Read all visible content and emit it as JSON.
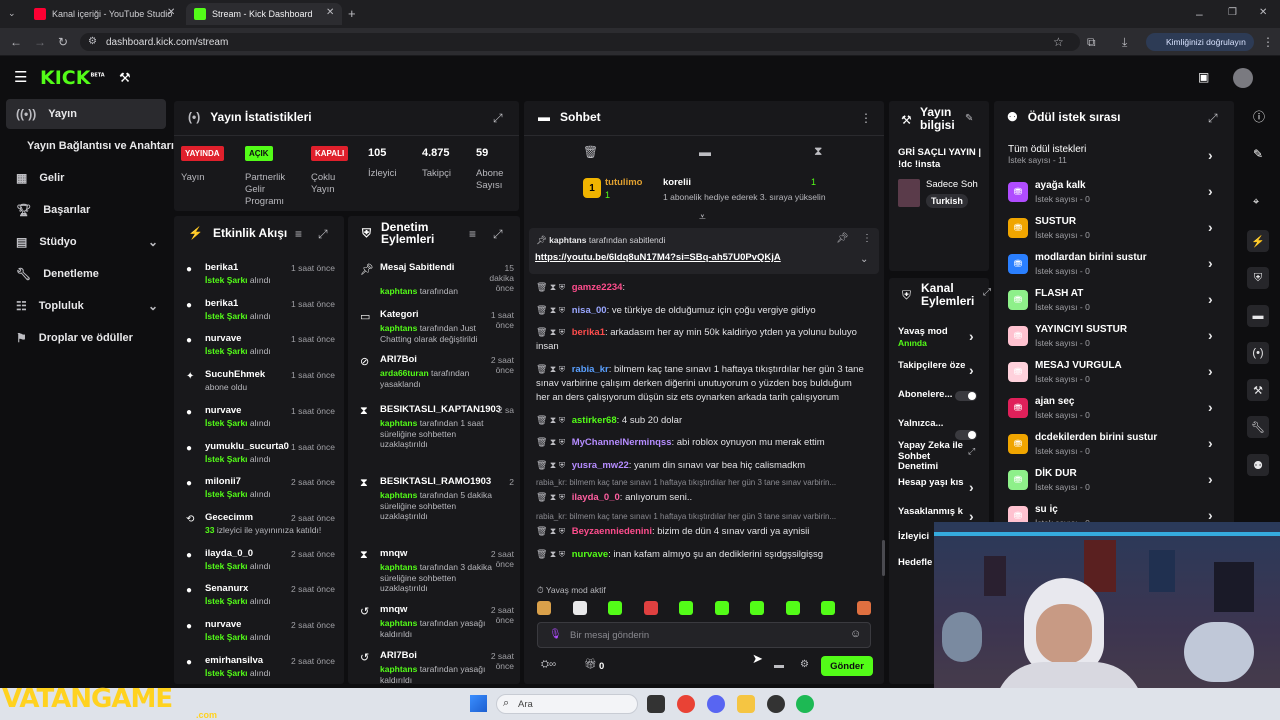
{
  "browser": {
    "tabs": [
      "Kanal içeriği - YouTube Studio",
      "Stream - Kick Dashboard"
    ],
    "url": "dashboard.kick.com/stream",
    "profile_pill": "Kimliğinizi doğrulayın"
  },
  "header": {
    "logo": "KICK",
    "beta": "BETA"
  },
  "sidebar": {
    "items": [
      {
        "label": "Yayın",
        "icon": "broadcast-icon"
      },
      {
        "label": "Yayın Bağlantısı ve Anahtarı",
        "icon": ""
      },
      {
        "label": "Gelir",
        "icon": "revenue-icon"
      },
      {
        "label": "Başarılar",
        "icon": "trophy-icon"
      },
      {
        "label": "Stüdyo",
        "icon": "studio-icon"
      },
      {
        "label": "Denetleme",
        "icon": "wrench-icon"
      },
      {
        "label": "Topluluk",
        "icon": "community-icon"
      },
      {
        "label": "Droplar ve ödüller",
        "icon": "drops-icon"
      }
    ]
  },
  "stats": {
    "title": "Yayın İstatistikleri",
    "cols": [
      {
        "badge": "YAYINDA",
        "label": "Yayın"
      },
      {
        "badge": "AÇIK",
        "label": "Partnerlik Gelir Programı"
      },
      {
        "badge": "KAPALI",
        "label": "Çoklu Yayın"
      },
      {
        "value": "105",
        "label": "İzleyici"
      },
      {
        "value": "4.875",
        "label": "Takipçi"
      },
      {
        "value": "59",
        "label": "Abone Sayısı"
      }
    ]
  },
  "activity": {
    "title": "Etkinlik Akışı",
    "items": [
      {
        "name": "berika1",
        "sub": "İstek Şarkı",
        "subtail": " alındı",
        "time": "1 saat önce"
      },
      {
        "name": "berika1",
        "sub": "İstek Şarkı",
        "subtail": " alındı",
        "time": "1 saat önce"
      },
      {
        "name": "nurvave",
        "sub": "İstek Şarkı",
        "subtail": " alındı",
        "time": "1 saat önce"
      },
      {
        "name": "SucuhEhmek",
        "sub": "",
        "subtail": "abone oldu",
        "time": "1 saat önce"
      },
      {
        "name": "nurvave",
        "sub": "İstek Şarkı",
        "subtail": " alındı",
        "time": "1 saat önce"
      },
      {
        "name": "yumuklu_sucurta0",
        "sub": "İstek Şarkı",
        "subtail": " alındı",
        "time": "1 saat önce"
      },
      {
        "name": "milonii7",
        "sub": "İstek Şarkı",
        "subtail": " alındı",
        "time": "2 saat önce"
      },
      {
        "name": "Gececimm",
        "sub": "33",
        "subtail": " izleyici ile yayınınıza katıldı!",
        "time": "2 saat önce"
      },
      {
        "name": "ilayda_0_0",
        "sub": "İstek Şarkı",
        "subtail": " alındı",
        "time": "2 saat önce"
      },
      {
        "name": "Senanurx",
        "sub": "İstek Şarkı",
        "subtail": " alındı",
        "time": "2 saat önce"
      },
      {
        "name": "nurvave",
        "sub": "İstek Şarkı",
        "subtail": " alındı",
        "time": "2 saat önce"
      },
      {
        "name": "emirhansilva",
        "sub": "İstek Şarkı",
        "subtail": " alındı",
        "time": "2 saat önce"
      }
    ]
  },
  "moderation": {
    "title": "Denetim Eylemleri",
    "items": [
      {
        "name": "Mesaj Sabitlendi",
        "actor": "kaphtans",
        "text": " tarafından",
        "time": "15 dakika önce"
      },
      {
        "name": "Kategori",
        "actor": "kaphtans",
        "text": " tarafından Just Chatting olarak değiştirildi",
        "time": "1 saat önce"
      },
      {
        "name": "ARI7Boi",
        "actor": "arda66turan",
        "text": " tarafından yasaklandı",
        "time": "2 saat önce"
      },
      {
        "name": "BESIKTASLI_KAPTAN1903",
        "actor": "kaphtans",
        "text": " tarafından 1 saat süreliğine sohbetten uzaklaştırıldı",
        "time": "2 sa"
      },
      {
        "name": "BESIKTASLI_RAMO1903",
        "actor": "kaphtans",
        "text": " tarafından 5 dakika süreliğine sohbetten uzaklaştırıldı",
        "time": "2"
      },
      {
        "name": "mnqw",
        "actor": "kaphtans",
        "text": " tarafından 3 dakika süreliğine sohbetten uzaklaştırıldı",
        "time": "2 saat önce"
      },
      {
        "name": "mnqw",
        "actor": "kaphtans",
        "text": " tarafından yasağı kaldırıldı",
        "time": "2 saat önce"
      },
      {
        "name": "ARI7Boi",
        "actor": "kaphtans",
        "text": " tarafından yasağı kaldırıldı",
        "time": "2 saat önce"
      }
    ]
  },
  "chat": {
    "title": "Sohbet",
    "top_user": "tutulimo",
    "top_user_count": "1",
    "top_user2": "korelii",
    "top_user2_count": "1",
    "top_user2_note": "1 abonelik hediye ederek 3. sıraya yükselin",
    "pinned_by": "kaphtans",
    "pinned_suffix": " tarafından sabitlendi",
    "pinned_link": "https://youtu.be/6ldq8uN17M4?si=SBq-ah57U0PvQKjA",
    "messages": [
      {
        "user": "gamze2234",
        "color": "#ff4d8d",
        "text": ":"
      },
      {
        "user": "nisa_00",
        "color": "#9aa7ff",
        "text": ": ve türkiye de olduğumuz için çoğu vergiye gidiyo"
      },
      {
        "user": "berika1",
        "color": "#ff4d4d",
        "text": ": arkadasım her ay min 50k kaldiriyo ytden ya yolunu buluyo insan"
      },
      {
        "user": "rabia_kr",
        "color": "#5aa0ff",
        "text": ": bilmem kaç tane sınavı 1 haftaya tıkıştırdılar her gün 3 tane sınav varbirine çalışım derken diğerini unutuyorum o yüzden boş bulduğum her an ders çalışıyorum düşün siz ets oynarken arkada tarih çalışıyorum"
      },
      {
        "user": "astirker68",
        "color": "#53fc18",
        "text": ": 4 sub 20 dolar"
      },
      {
        "user": "MyChannelNerminqss",
        "color": "#b58cff",
        "text": ": abi roblox oynuyon mu merak ettim"
      },
      {
        "user": "yusra_mw22",
        "color": "#b58cff",
        "text": ": yanım din sınavı var bea hiç calismadkm"
      },
      {
        "reply": "rabia_kr: bilmem kaç tane sınavı 1 haftaya tıkıştırdılar her gün 3 tane sınav varbirin...",
        "user": "ilayda_0_0",
        "color": "#ff5fa0",
        "text": ": anlıyorum seni.."
      },
      {
        "reply": "rabia_kr: bilmem kaç tane sınavı 1 haftaya tıkıştırdılar her gün 3 tane sınav varbirin...",
        "user": "Beyzaenniedenini",
        "color": "#ff4d8d",
        "text": ": bizim de dün 4 sınav vardi ya aynisii"
      },
      {
        "user": "nurvave",
        "color": "#53fc18",
        "text": ": inan kafam almıyo şu an dediklerini sşıdgşsilgişsg"
      }
    ],
    "slow_mode": "Yavaş mod aktif",
    "input_placeholder": "Bir mesaj gönderin",
    "points": "0",
    "send": "Gönder"
  },
  "stream_info": {
    "title": "Yayın bilgisi",
    "stream_title": "GRİ SAÇLI YAYIN | !dc !insta",
    "category": "Sadece Soh",
    "language": "Turkish"
  },
  "channel_actions": {
    "title": "Kanal Eylemleri",
    "items": [
      {
        "label": "Yavaş mod",
        "sub": "Anında"
      },
      {
        "label": "Takipçilere öze",
        "sub": ""
      },
      {
        "label": "Abonelere...",
        "sub": ""
      },
      {
        "label": "Yalnızca...",
        "sub": ""
      },
      {
        "label": "Yapay Zeka ile Sohbet Denetimi",
        "sub": ""
      },
      {
        "label": "Hesap yaşı kıs",
        "sub": ""
      },
      {
        "label": "Yasaklanmış k",
        "sub": ""
      },
      {
        "label": "İzleyici",
        "sub": ""
      },
      {
        "label": "Hedefle",
        "sub": ""
      }
    ]
  },
  "rewards": {
    "title": "Ödül istek sırası",
    "all": "Tüm ödül istekleri",
    "all_sub": "İstek sayısı - 11",
    "items": [
      {
        "name": "ayağa kalk",
        "sub": "İstek sayısı - 0",
        "color": "#b04cff"
      },
      {
        "name": "SUSTUR",
        "sub": "İstek sayısı - 0",
        "color": "#f0a500"
      },
      {
        "name": "modlardan birini sustur",
        "sub": "İstek sayısı - 0",
        "color": "#2a7fff"
      },
      {
        "name": "FLASH AT",
        "sub": "İstek sayısı - 0",
        "color": "#8ef08a"
      },
      {
        "name": "YAYINCIYI SUSTUR",
        "sub": "İstek sayısı - 0",
        "color": "#ffc2d0"
      },
      {
        "name": "MESAJ VURGULA",
        "sub": "İstek sayısı - 0",
        "color": "#ffd1dc"
      },
      {
        "name": "ajan seç",
        "sub": "İstek sayısı - 0",
        "color": "#e0205a"
      },
      {
        "name": "dcdekilerden birini sustur",
        "sub": "İstek sayısı - 0",
        "color": "#f0a500"
      },
      {
        "name": "DİK DUR",
        "sub": "İstek sayısı - 0",
        "color": "#8ef08a"
      },
      {
        "name": "su iç",
        "sub": "İstek sayısı - 0",
        "color": "#ffc2d0"
      }
    ]
  },
  "taskbar": {
    "search": "Ara"
  },
  "watermark": {
    "text": "VATANGAME",
    "sub": ".com"
  },
  "colors": {
    "accent": "#53fc18",
    "panel": "#18181b",
    "bg": "#0e0e10"
  }
}
